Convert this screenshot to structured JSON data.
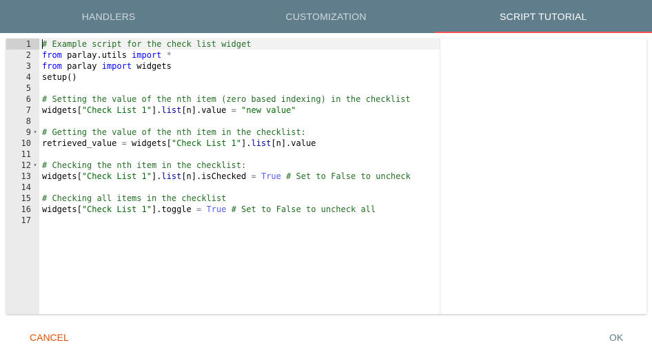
{
  "tabs": [
    {
      "label": "HANDLERS",
      "active": false
    },
    {
      "label": "CUSTOMIZATION",
      "active": false
    },
    {
      "label": "SCRIPT TUTORIAL",
      "active": true
    }
  ],
  "editor": {
    "language": "python",
    "active_line": 1,
    "lines": [
      {
        "num": "1",
        "fold": "",
        "tokens": [
          [
            "cmt",
            "# Example script for the check list widget"
          ]
        ]
      },
      {
        "num": "2",
        "fold": "",
        "tokens": [
          [
            "kw",
            "from"
          ],
          [
            "id",
            " parlay.utils "
          ],
          [
            "kw",
            "import"
          ],
          [
            "id",
            " "
          ],
          [
            "op",
            "*"
          ]
        ]
      },
      {
        "num": "3",
        "fold": "",
        "tokens": [
          [
            "kw",
            "from"
          ],
          [
            "id",
            " parlay "
          ],
          [
            "kw",
            "import"
          ],
          [
            "id",
            " widgets"
          ]
        ]
      },
      {
        "num": "4",
        "fold": "",
        "tokens": [
          [
            "id",
            "setup()"
          ]
        ]
      },
      {
        "num": "5",
        "fold": "",
        "tokens": []
      },
      {
        "num": "6",
        "fold": "",
        "tokens": [
          [
            "cmt",
            "# Setting the value of the nth item (zero based indexing) in the checklist"
          ]
        ]
      },
      {
        "num": "7",
        "fold": "",
        "tokens": [
          [
            "id",
            "widgets["
          ],
          [
            "str",
            "\"Check List 1\""
          ],
          [
            "id",
            "]."
          ],
          [
            "sup",
            "list"
          ],
          [
            "id",
            "[n].value "
          ],
          [
            "op",
            "="
          ],
          [
            "id",
            " "
          ],
          [
            "str",
            "\"new value\""
          ]
        ]
      },
      {
        "num": "8",
        "fold": "",
        "tokens": []
      },
      {
        "num": "9",
        "fold": "▾",
        "tokens": [
          [
            "cmt",
            "# Getting the value of the nth item in the checklist:"
          ]
        ]
      },
      {
        "num": "10",
        "fold": "",
        "tokens": [
          [
            "id",
            "retrieved_value "
          ],
          [
            "op",
            "="
          ],
          [
            "id",
            " widgets["
          ],
          [
            "str",
            "\"Check List 1\""
          ],
          [
            "id",
            "]."
          ],
          [
            "sup",
            "list"
          ],
          [
            "id",
            "[n].value"
          ]
        ]
      },
      {
        "num": "11",
        "fold": "",
        "tokens": []
      },
      {
        "num": "12",
        "fold": "▾",
        "tokens": [
          [
            "cmt",
            "# Checking the nth item in the checklist:"
          ]
        ]
      },
      {
        "num": "13",
        "fold": "",
        "tokens": [
          [
            "id",
            "widgets["
          ],
          [
            "str",
            "\"Check List 1\""
          ],
          [
            "id",
            "]."
          ],
          [
            "sup",
            "list"
          ],
          [
            "id",
            "[n].isChecked "
          ],
          [
            "op",
            "="
          ],
          [
            "id",
            " "
          ],
          [
            "bool",
            "True"
          ],
          [
            "id",
            " "
          ],
          [
            "cmt",
            "# Set to False to uncheck"
          ]
        ]
      },
      {
        "num": "14",
        "fold": "",
        "tokens": []
      },
      {
        "num": "15",
        "fold": "",
        "tokens": [
          [
            "cmt",
            "# Checking all items in the checklist"
          ]
        ]
      },
      {
        "num": "16",
        "fold": "",
        "tokens": [
          [
            "id",
            "widgets["
          ],
          [
            "str",
            "\"Check List 1\""
          ],
          [
            "id",
            "].toggle "
          ],
          [
            "op",
            "="
          ],
          [
            "id",
            " "
          ],
          [
            "bool",
            "True"
          ],
          [
            "id",
            " "
          ],
          [
            "cmt",
            "# Set to False to uncheck all"
          ]
        ]
      },
      {
        "num": "17",
        "fold": "",
        "tokens": []
      }
    ]
  },
  "footer": {
    "cancel_label": "CANCEL",
    "ok_label": "OK"
  },
  "colors": {
    "tabbar": "#607d8b",
    "tab_ink": "#ff5252",
    "cancel": "#e65100",
    "ok": "#607d8b"
  }
}
